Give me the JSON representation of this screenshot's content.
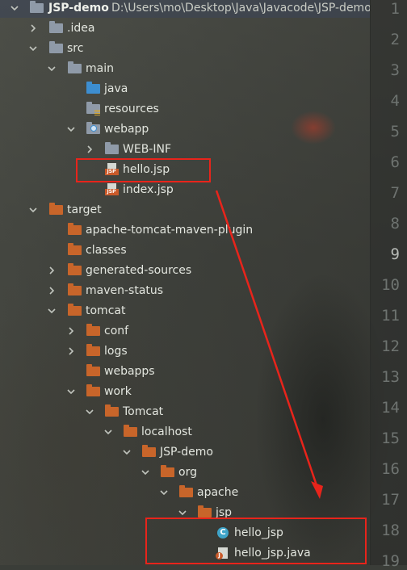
{
  "project": {
    "name": "JSP-demo",
    "path": "D:\\Users\\mo\\Desktop\\Java\\Javacode\\JSP-demo"
  },
  "tree": [
    {
      "label": "JSP-demo",
      "indent": 0,
      "expanded": true,
      "icon": "project-folder-icon"
    },
    {
      "label": ".idea",
      "indent": 1,
      "expanded": false,
      "icon": "folder-icon"
    },
    {
      "label": "src",
      "indent": 1,
      "expanded": true,
      "icon": "folder-icon"
    },
    {
      "label": "main",
      "indent": 2,
      "expanded": true,
      "icon": "folder-icon"
    },
    {
      "label": "java",
      "indent": 3,
      "icon": "source-folder-icon"
    },
    {
      "label": "resources",
      "indent": 3,
      "icon": "resources-folder-icon"
    },
    {
      "label": "webapp",
      "indent": 3,
      "expanded": true,
      "icon": "web-folder-icon"
    },
    {
      "label": "WEB-INF",
      "indent": 4,
      "expanded": false,
      "icon": "folder-icon"
    },
    {
      "label": "hello.jsp",
      "indent": 4,
      "icon": "jsp-file-icon"
    },
    {
      "label": "index.jsp",
      "indent": 4,
      "icon": "jsp-file-icon"
    },
    {
      "label": "target",
      "indent": 1,
      "expanded": true,
      "icon": "excluded-folder-icon"
    },
    {
      "label": "apache-tomcat-maven-plugin",
      "indent": 2,
      "icon": "excluded-folder-icon"
    },
    {
      "label": "classes",
      "indent": 2,
      "icon": "excluded-folder-icon"
    },
    {
      "label": "generated-sources",
      "indent": 2,
      "expanded": false,
      "icon": "excluded-folder-icon"
    },
    {
      "label": "maven-status",
      "indent": 2,
      "expanded": false,
      "icon": "excluded-folder-icon"
    },
    {
      "label": "tomcat",
      "indent": 2,
      "expanded": true,
      "icon": "excluded-folder-icon"
    },
    {
      "label": "conf",
      "indent": 3,
      "expanded": false,
      "icon": "excluded-folder-icon"
    },
    {
      "label": "logs",
      "indent": 3,
      "expanded": false,
      "icon": "excluded-folder-icon"
    },
    {
      "label": "webapps",
      "indent": 3,
      "icon": "excluded-folder-icon"
    },
    {
      "label": "work",
      "indent": 3,
      "expanded": true,
      "icon": "excluded-folder-icon"
    },
    {
      "label": "Tomcat",
      "indent": 4,
      "expanded": true,
      "icon": "excluded-folder-icon"
    },
    {
      "label": "localhost",
      "indent": 5,
      "expanded": true,
      "icon": "excluded-folder-icon"
    },
    {
      "label": "JSP-demo",
      "indent": 6,
      "expanded": true,
      "icon": "excluded-folder-icon"
    },
    {
      "label": "org",
      "indent": 7,
      "expanded": true,
      "icon": "excluded-folder-icon"
    },
    {
      "label": "apache",
      "indent": 8,
      "expanded": true,
      "icon": "excluded-folder-icon"
    },
    {
      "label": "jsp",
      "indent": 9,
      "expanded": true,
      "icon": "excluded-folder-icon"
    },
    {
      "label": "hello_jsp",
      "indent": 10,
      "icon": "class-file-icon"
    },
    {
      "label": "hello_jsp.java",
      "indent": 10,
      "icon": "java-file-icon"
    }
  ],
  "line_numbers": [
    "1",
    "2",
    "3",
    "4",
    "5",
    "6",
    "7",
    "8",
    "9",
    "10",
    "11",
    "12",
    "13",
    "14",
    "15",
    "16",
    "17",
    "18",
    "19"
  ],
  "current_line": "9",
  "colors": {
    "highlight": "#e8241b",
    "excluded_folder": "#c8652a",
    "source_folder": "#3d8ed0"
  }
}
